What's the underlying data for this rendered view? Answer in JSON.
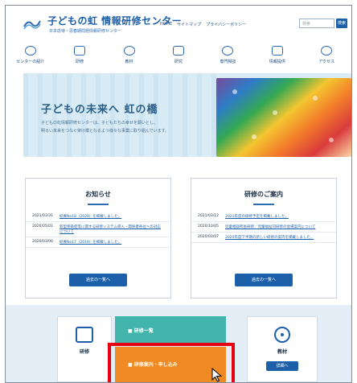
{
  "header": {
    "site_title": "子どもの虹 情報研修センター",
    "site_subtitle": "日本虐待・思春期問題情報研修センター",
    "links": [
      "HOME",
      "サイトマップ",
      "プライバシーポリシー"
    ],
    "search_placeholder": "検索",
    "search_button": "検索"
  },
  "nav": {
    "items": [
      {
        "label": "センターの紹介",
        "icon": "info-icon"
      },
      {
        "label": "研修",
        "icon": "training-icon"
      },
      {
        "label": "教材",
        "icon": "material-icon"
      },
      {
        "label": "研究",
        "icon": "research-icon"
      },
      {
        "label": "専門相談",
        "icon": "consult-icon"
      },
      {
        "label": "情報提供",
        "icon": "document-icon"
      },
      {
        "label": "アクセス",
        "icon": "location-icon"
      }
    ]
  },
  "hero": {
    "title": "子どもの未来へ 虹の橋",
    "line1": "子どもの虹情報研修センターは、子どもたちの幸せを願いとし、",
    "line2": "明るい未来をつなぐ架け橋となるよう様々な事業に取り組んでいます。"
  },
  "news": {
    "title": "お知らせ",
    "items": [
      {
        "date": "2021/03/31",
        "text": "紀要No18（2020）を掲載しました。"
      },
      {
        "date": "2020/05/01",
        "text": "新型感染症等に関する研修システム導入・関係者各位への対応について"
      },
      {
        "date": "2020/03/06",
        "text": "紀要No17（2019）を掲載しました。"
      }
    ],
    "button": "過去の一覧へ"
  },
  "training": {
    "title": "研修のご案内",
    "items": [
      {
        "date": "2021/03/12",
        "text": "2021年度の研修予定を掲載しました。"
      },
      {
        "date": "2020/10/05",
        "text": "児童相談所長研修／児童福祉司研修の会場案内について"
      },
      {
        "date": "2020/03/07",
        "text": "2020年度下半期の新しい研修の案内を掲載しました。"
      }
    ],
    "button": "過去の一覧へ"
  },
  "bottom": {
    "training_label": "研修",
    "list_label": "研修一覧",
    "apply_label": "研修案内・申し込み",
    "material_label": "教材",
    "material_button": "詳細へ"
  },
  "colors": {
    "brand": "#1d5fa8",
    "teal": "#44b5ac",
    "orange": "#ef8a24",
    "highlight": "#e60012"
  }
}
